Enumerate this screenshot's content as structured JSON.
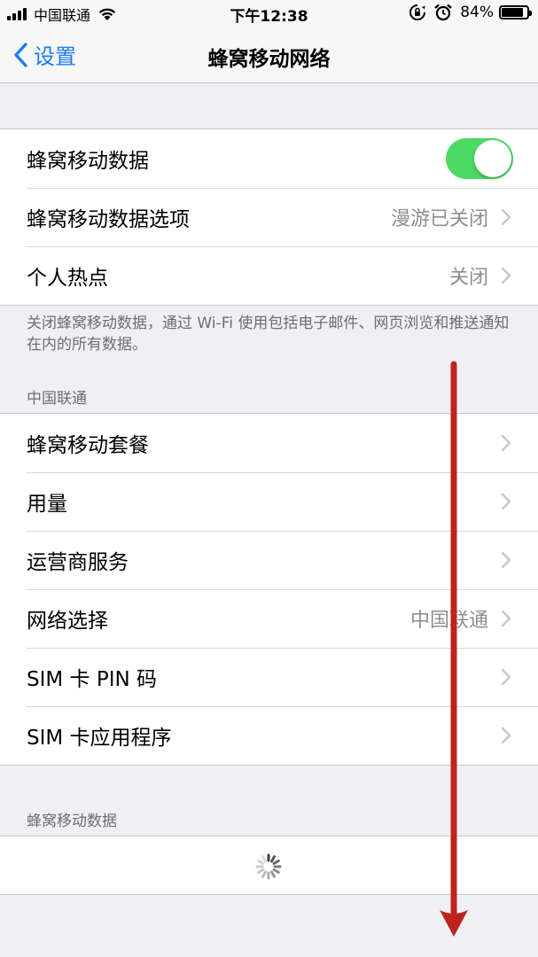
{
  "status_bar": {
    "carrier": "中国联通",
    "time": "下午12:38",
    "battery": "84%",
    "battery_level": 0.84
  },
  "nav": {
    "back_label": "设置",
    "title": "蜂窝移动网络"
  },
  "group1": {
    "cellular_data": {
      "label": "蜂窝移动数据",
      "on": true
    },
    "cellular_options": {
      "label": "蜂窝移动数据选项",
      "value": "漫游已关闭"
    },
    "hotspot": {
      "label": "个人热点",
      "value": "关闭"
    }
  },
  "footer_note": "关闭蜂窝移动数据，通过 Wi-Fi 使用包括电子邮件、网页浏览和推送通知在内的所有数据。",
  "carrier_section": {
    "header": "中国联通",
    "items": [
      {
        "label": "蜂窝移动套餐",
        "value": ""
      },
      {
        "label": "用量",
        "value": ""
      },
      {
        "label": "运营商服务",
        "value": ""
      },
      {
        "label": "网络选择",
        "value": "中国联通"
      },
      {
        "label": "SIM 卡 PIN 码",
        "value": ""
      },
      {
        "label": "SIM 卡应用程序",
        "value": ""
      }
    ]
  },
  "data_section": {
    "header": "蜂窝移动数据"
  },
  "colors": {
    "accent": "#1a7cf5",
    "toggle_on": "#4cd964",
    "arrow": "#c0221e"
  }
}
